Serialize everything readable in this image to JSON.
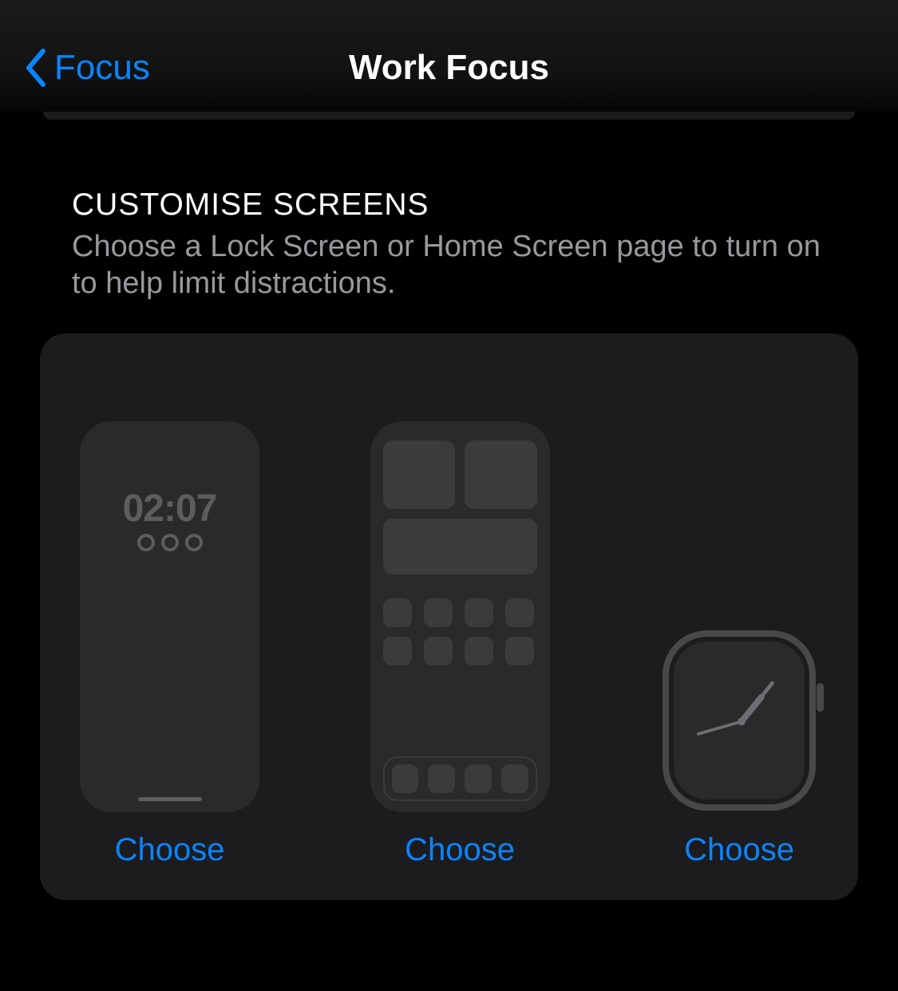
{
  "header": {
    "back_label": "Focus",
    "title": "Work Focus"
  },
  "section": {
    "title": "CUSTOMISE SCREENS",
    "description": "Choose a Lock Screen or Home Screen page to turn on to help limit distractions."
  },
  "previews": {
    "lock_screen": {
      "time": "02:07",
      "choose_label": "Choose"
    },
    "home_screen": {
      "choose_label": "Choose"
    },
    "watch": {
      "choose_label": "Choose"
    }
  },
  "colors": {
    "accent": "#0a84ff",
    "background": "#000000",
    "card": "#1c1c1e",
    "preview_bg": "#2a2a2c",
    "preview_fg": "#3b3b3d",
    "muted_text": "#98989d"
  }
}
